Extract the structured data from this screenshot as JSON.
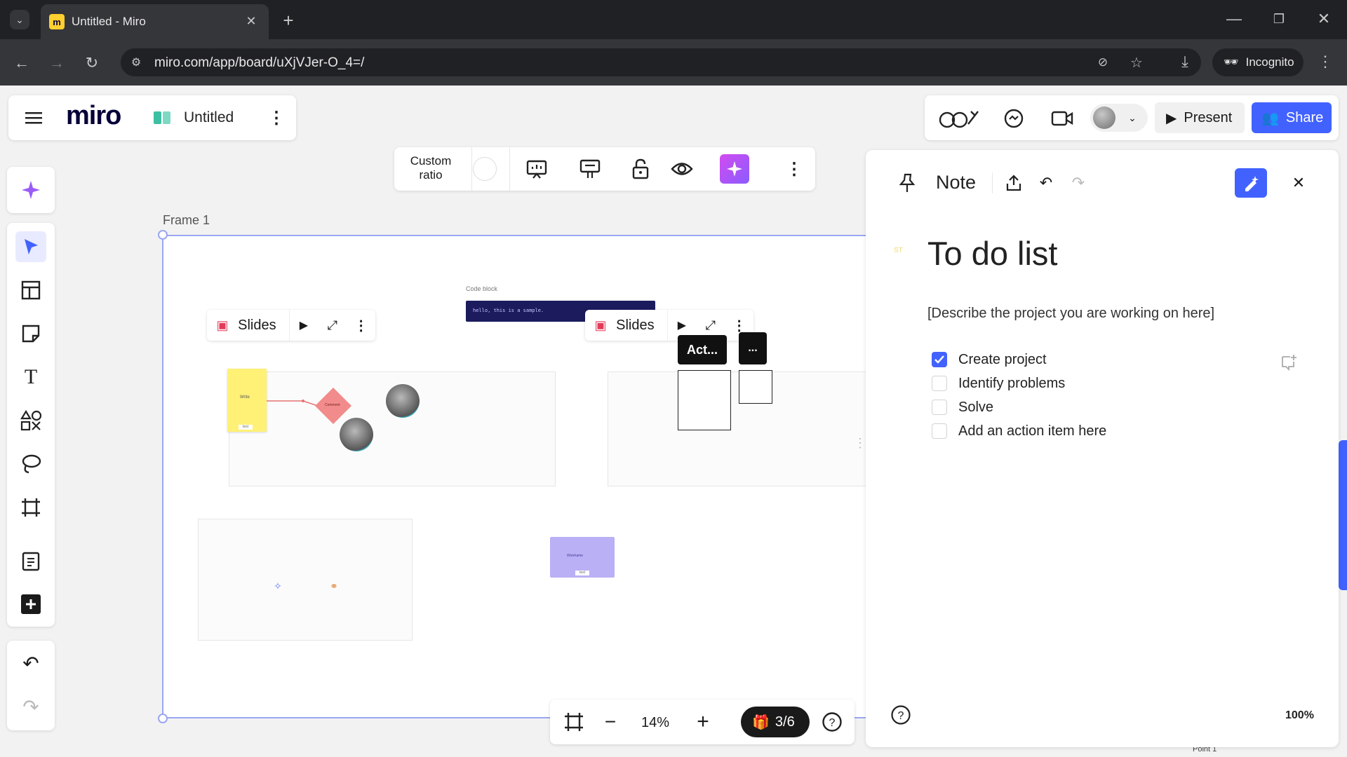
{
  "browser": {
    "tab_title": "Untitled - Miro",
    "url": "miro.com/app/board/uXjVJer-O_4=/",
    "incognito_label": "Incognito"
  },
  "header": {
    "logo": "miro",
    "board_name": "Untitled",
    "present_label": "Present",
    "share_label": "Share"
  },
  "frame_toolbar": {
    "ratio_line1": "Custom",
    "ratio_line2": "ratio"
  },
  "canvas": {
    "frame_label": "Frame 1",
    "slides_label_1": "Slides",
    "slides_label_2": "Slides",
    "code_block_label": "Code block",
    "code_block_text": "hello, this is a sample.",
    "act_label": "Act...",
    "more_label": "...",
    "sticky_text": "Write",
    "sticky_tag": "text",
    "diamond_text": "Comment",
    "purple_card_text": "Wireframe",
    "purple_card_tag": "text",
    "point_label": "Point 1"
  },
  "bottom_bar": {
    "zoom": "14%",
    "slides_count": "3/6"
  },
  "note_panel": {
    "title": "Note",
    "heading": "To do list",
    "description": "[Describe the project you are working on here]",
    "zoom": "100%",
    "todos": [
      {
        "text": "Create project",
        "checked": true
      },
      {
        "text": "Identify problems",
        "checked": false
      },
      {
        "text": "Solve",
        "checked": false
      },
      {
        "text": "Add an action item here",
        "checked": false
      }
    ]
  },
  "colors": {
    "accent": "#4262ff",
    "sticky": "#fff176",
    "diamond": "#f28b8b",
    "purple_card": "#b9b0f5",
    "code_bg": "#1b1b5e",
    "frame_border": "#9aa6f2"
  }
}
